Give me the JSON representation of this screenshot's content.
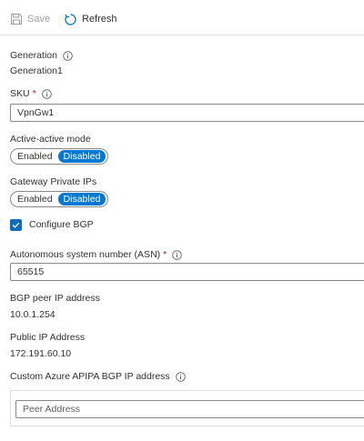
{
  "toolbar": {
    "save_label": "Save",
    "refresh_label": "Refresh"
  },
  "generation": {
    "label": "Generation",
    "value": "Generation1"
  },
  "sku": {
    "label": "SKU",
    "required_mark": "*",
    "value": "VpnGw1"
  },
  "active_active": {
    "label": "Active-active mode",
    "options": [
      "Enabled",
      "Disabled"
    ],
    "selected": "Disabled"
  },
  "gateway_private_ips": {
    "label": "Gateway Private IPs",
    "options": [
      "Enabled",
      "Disabled"
    ],
    "selected": "Disabled"
  },
  "configure_bgp": {
    "label": "Configure BGP",
    "checked": true
  },
  "asn": {
    "label": "Autonomous system number (ASN)",
    "required_mark": "*",
    "value": "65515"
  },
  "bgp_peer_ip": {
    "label": "BGP peer IP address",
    "value": "10.0.1.254"
  },
  "public_ip": {
    "label": "Public IP Address",
    "value": "172.191.60.10"
  },
  "custom_apipa": {
    "label": "Custom Azure APIPA BGP IP address",
    "placeholder": "Peer Address"
  },
  "colors": {
    "accent": "#0078d4",
    "required": "#a4262c",
    "disabled_text": "#a19f9d",
    "text": "#323130",
    "border": "#8a8886"
  }
}
